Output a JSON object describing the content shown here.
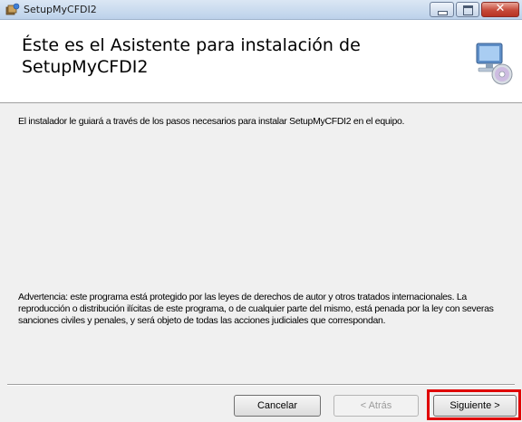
{
  "window": {
    "title": "SetupMyCFDI2",
    "close_glyph": "✕",
    "icons": [
      "installer-app-icon",
      "minimize-icon",
      "maximize-icon",
      "close-icon"
    ]
  },
  "banner": {
    "title": "Éste es el Asistente para instalación de SetupMyCFDI2",
    "icon": "computer-cd-icon"
  },
  "content": {
    "intro": "El instalador le guiará a través de los pasos necesarios para instalar SetupMyCFDI2 en el equipo.",
    "warning": "Advertencia: este programa está protegido por las leyes de derechos de autor y otros tratados internacionales. La reproducción o distribución ilícitas de este programa, o de cualquier parte del mismo, está penada por la ley con severas sanciones civiles y penales, y será objeto de todas las acciones judiciales que correspondan."
  },
  "buttons": {
    "cancel": "Cancelar",
    "back": "< Atrás",
    "next": "Siguiente >"
  },
  "colors": {
    "highlight": "#e00000",
    "titlebar": "#bcd1ea",
    "close_button": "#c64a3a"
  }
}
